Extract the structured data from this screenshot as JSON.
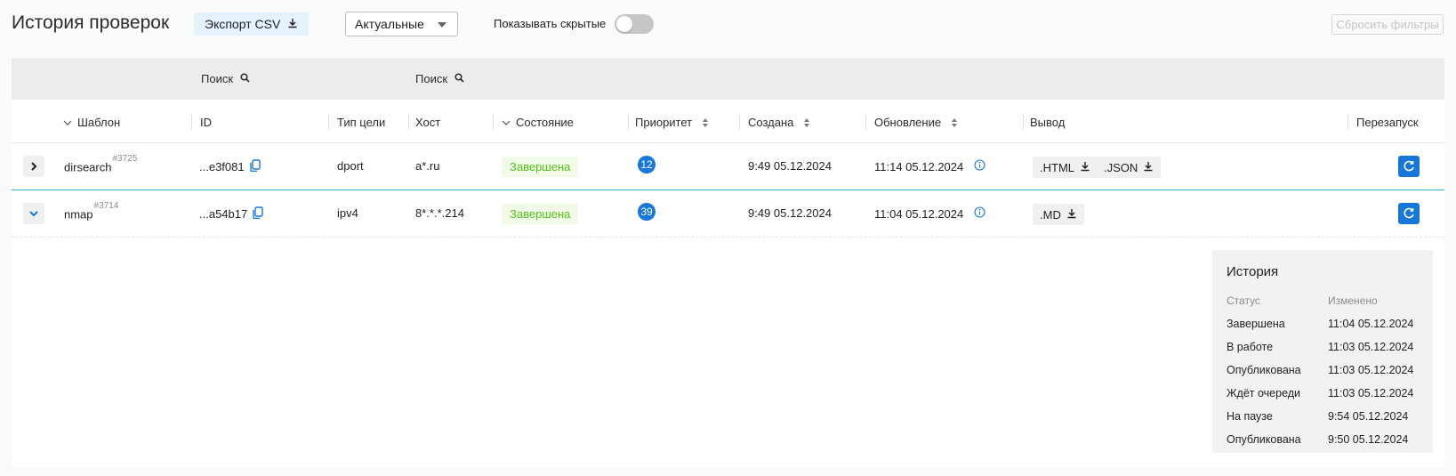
{
  "header": {
    "title": "История проверок",
    "export_label": "Экспорт CSV",
    "filter_select": "Актуальные",
    "toggle_label": "Показывать скрытые",
    "toggle_on": false,
    "reset_label": "Сбросить фильтры"
  },
  "filters": {
    "search1": "Поиск",
    "search2": "Поиск"
  },
  "columns": {
    "template": "Шаблон",
    "id": "ID",
    "target_type": "Тип цели",
    "host": "Хост",
    "state": "Состояние",
    "priority": "Приоритет",
    "created": "Создана",
    "updated": "Обновление",
    "output": "Вывод",
    "rerun": "Перезапуск"
  },
  "rows": [
    {
      "template": "dirsearch",
      "num": "#3725",
      "id": "...e3f081",
      "target_type": "dport",
      "host": "a*.ru",
      "state": "Завершена",
      "priority": "12",
      "created": "9:49 05.12.2024",
      "updated": "11:14 05.12.2024",
      "outputs": [
        ".HTML",
        ".JSON"
      ],
      "expanded": false
    },
    {
      "template": "nmap",
      "num": "#3714",
      "id": "...a54b17",
      "target_type": "ipv4",
      "host": "8*.*.*.214",
      "state": "Завершена",
      "priority": "39",
      "created": "9:49 05.12.2024",
      "updated": "11:04 05.12.2024",
      "outputs": [
        ".MD"
      ],
      "expanded": true
    }
  ],
  "history": {
    "title": "История",
    "col_status": "Статус",
    "col_changed": "Изменено",
    "entries": [
      {
        "status": "Завершена",
        "changed": "11:04 05.12.2024"
      },
      {
        "status": "В работе",
        "changed": "11:03 05.12.2024"
      },
      {
        "status": "Опубликована",
        "changed": "11:03 05.12.2024"
      },
      {
        "status": "Ждёт очереди",
        "changed": "11:03 05.12.2024"
      },
      {
        "status": "На паузе",
        "changed": "9:54 05.12.2024"
      },
      {
        "status": "Опубликована",
        "changed": "9:50 05.12.2024"
      }
    ]
  },
  "colors": {
    "accent": "#1677d9",
    "status_green": "#52c41a",
    "selected_row_border": "#36b5d8",
    "export_bg": "#e4f2fc"
  }
}
